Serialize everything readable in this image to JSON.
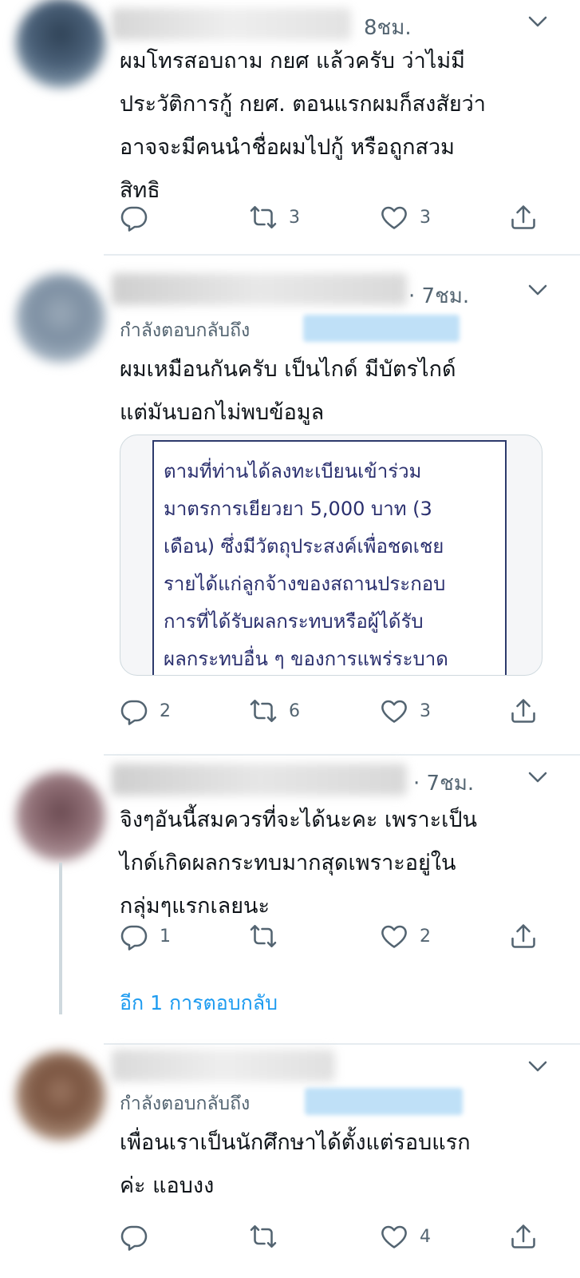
{
  "tweets": [
    {
      "time": "8ชม.",
      "text": "ผมโทรสอบถาม กยศ แล้วครับ ว่าไม่มีประวัติการกู้ กยศ. ตอนแรกผมก็สงสัยว่าอาจจะมีคนนำชื่อผมไปกู้ หรือถูกสวมสิทธิ",
      "text_lines": [
        "ผมโทรสอบถาม กยศ แล้วครับ ว่าไม่มี",
        "ประวัติการกู้ กยศ. ตอนแรกผมก็สงสัยว่า",
        "อาจจะมีคนนำชื่อผมไปกู้ หรือถูกสวม",
        "สิทธิ"
      ],
      "reply_count": "",
      "retweet_count": "3",
      "like_count": "3"
    },
    {
      "time": "· 7ชม.",
      "replying_to": "กำลังตอบกลับถึง",
      "text_lines": [
        "ผมเหมือนกันครับ เป็นไกด์ มีบัตรไกด์",
        "แต่มันบอกไม่พบข้อมูล"
      ],
      "media_lines": [
        "ตามที่ท่านได้ลงทะเบียนเข้าร่วม",
        "มาตรการเยียวยา 5,000 บาท (3",
        "เดือน) ซึ่งมีวัตถุประสงค์เพื่อชดเชย",
        "รายได้แก่ลูกจ้างของสถานประกอบ",
        "การที่ได้รับผลกระทบหรือผู้ได้รับ",
        "ผลกระทบอื่น ๆ ของการแพร่ระบาด"
      ],
      "reply_count": "2",
      "retweet_count": "6",
      "like_count": "3"
    },
    {
      "time": "· 7ชม.",
      "text_lines": [
        "จิงๆอันนี้สมควรที่จะได้นะคะ เพราะเป็น",
        "ไกด์เกิดผลกระทบมากสุดเพราะอยู่ใน",
        "กลุ่มๆแรกเลยนะ"
      ],
      "reply_count": "1",
      "retweet_count": "",
      "like_count": "2",
      "more_replies": "อีก 1 การตอบกลับ"
    },
    {
      "replying_to": "กำลังตอบกลับถึง",
      "text_lines": [
        "เพื่อนเราเป็นนักศึกษาได้ตั้งแต่รอบแรก",
        "ค่ะ แอบงง"
      ],
      "reply_count": "",
      "retweet_count": "",
      "like_count": "4"
    }
  ],
  "icons": {
    "reply": "reply-icon",
    "retweet": "retweet-icon",
    "like": "heart-icon",
    "share": "share-icon",
    "menu": "chevron-down-icon"
  },
  "colors": {
    "accent": "#1d9bf0",
    "secondary_text": "#536471",
    "divider": "#e6ecf0"
  }
}
